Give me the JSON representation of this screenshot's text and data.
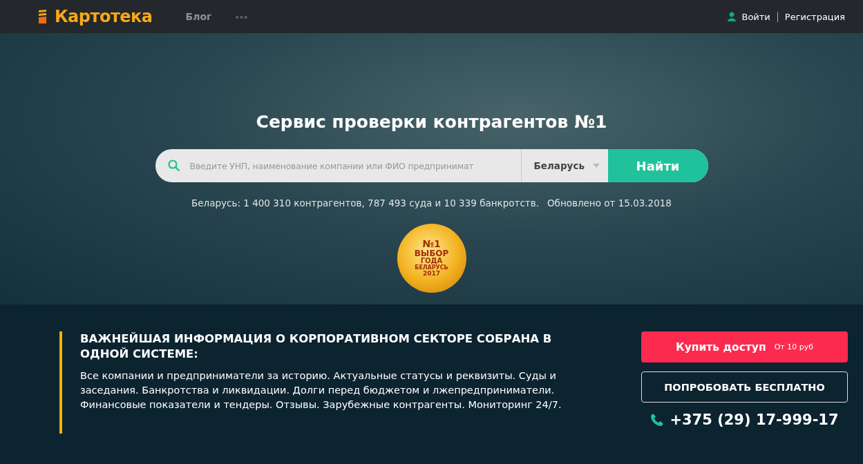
{
  "header": {
    "logo": "Картотека",
    "nav": [
      {
        "label": "Блог"
      }
    ],
    "more": "•••",
    "login": "Войти",
    "register": "Регистрация"
  },
  "hero": {
    "title": "Сервис проверки контрагентов №1",
    "search": {
      "placeholder": "Введите УНП, наименование компании или ФИО предпринимат",
      "country": "Беларусь",
      "button": "Найти"
    },
    "stats": [
      {
        "text": "Беларусь:  1 400 310 контрагентов, 787 493 суда и 10 339 банкротств."
      },
      {
        "text": "Обновлено от 15.03.2018"
      }
    ],
    "badge": {
      "lines": [
        "№1",
        "ВЫБОР",
        "ГОДА",
        "БЕЛАРУСЬ",
        "2017"
      ]
    }
  },
  "info": {
    "heading": "ВАЖНЕЙШАЯ ИНФОРМАЦИЯ О КОРПОРАТИВНОМ СЕКТОРЕ СОБРАНА В ОДНОЙ СИСТЕМЕ:",
    "text": "Все компании и предприниматели за историю. Актуальные статусы и реквизиты. Суды и заседания. Банкротства и ликвидации. Долги перед бюджетом и лжепредприниматели. Финансовые показатели и тендеры. Отзывы. Зарубежные контрагенты. Мониторинг 24/7."
  },
  "cta": {
    "buy": "Купить доступ",
    "buy_note": "От 10 руб",
    "trial": "ПОПРОБОВАТЬ БЕСПЛАТНО",
    "phone": "+375 (29) 17-999-17"
  }
}
